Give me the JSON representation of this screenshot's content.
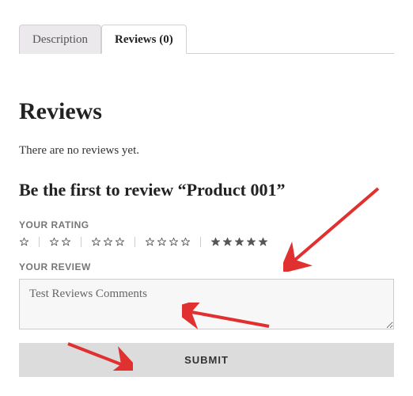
{
  "tabs": [
    {
      "label": "Description",
      "active": false
    },
    {
      "label": "Reviews (0)",
      "active": true
    }
  ],
  "reviews": {
    "heading": "Reviews",
    "empty_message": "There are no reviews yet.",
    "prompt": "Be the first to review “Product 001”",
    "rating_label": "YOUR RATING",
    "rating_groups": [
      1,
      2,
      3,
      4,
      5
    ],
    "selected_rating": 5,
    "review_label": "YOUR REVIEW",
    "review_text": "Test Reviews Comments",
    "submit_label": "SUBMIT"
  },
  "annotations": {
    "arrows": [
      {
        "target": "rating-5-stars"
      },
      {
        "target": "review-textarea"
      },
      {
        "target": "submit-button"
      }
    ]
  }
}
